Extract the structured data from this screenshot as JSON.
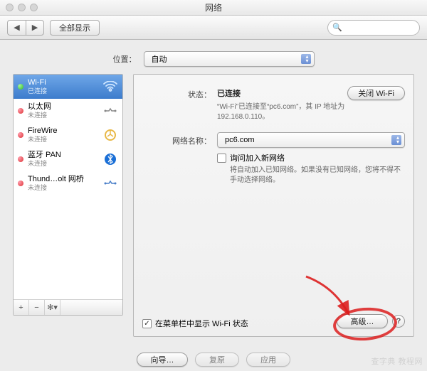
{
  "window": {
    "title": "网络"
  },
  "toolbar": {
    "showAll": "全部显示"
  },
  "location": {
    "label": "位置：",
    "value": "自动"
  },
  "sidebar": {
    "items": [
      {
        "name": "Wi-Fi",
        "status": "已连接",
        "state": "green",
        "selected": true,
        "icon": "wifi"
      },
      {
        "name": "以太网",
        "status": "未连接",
        "state": "red",
        "selected": false,
        "icon": "ethernet"
      },
      {
        "name": "FireWire",
        "status": "未连接",
        "state": "red",
        "selected": false,
        "icon": "firewire"
      },
      {
        "name": "蓝牙 PAN",
        "status": "未连接",
        "state": "red",
        "selected": false,
        "icon": "bluetooth"
      },
      {
        "name": "Thund…olt 网桥",
        "status": "未连接",
        "state": "red",
        "selected": false,
        "icon": "thunderbolt"
      }
    ],
    "foot": {
      "add": "+",
      "remove": "−",
      "gear": "✻▾"
    }
  },
  "main": {
    "statusLabel": "状态：",
    "statusValue": "已连接",
    "toggleBtn": "关闭 Wi-Fi",
    "statusDetail": "“Wi-Fi”已连接至“pc6.com”，其 IP 地址为 192.168.0.110。",
    "networkNameLabel": "网络名称：",
    "networkNameValue": "pc6.com",
    "askJoin": "询问加入新网络",
    "askJoinHint": "将自动加入已知网络。如果没有已知网络，您将不得不手动选择网络。",
    "showMenuBar": "在菜单栏中显示 Wi-Fi 状态",
    "advanced": "高级…",
    "help": "?"
  },
  "footer": {
    "assist": "向导…",
    "revert": "复原",
    "apply": "应用"
  },
  "watermark": "查字典 教程网"
}
